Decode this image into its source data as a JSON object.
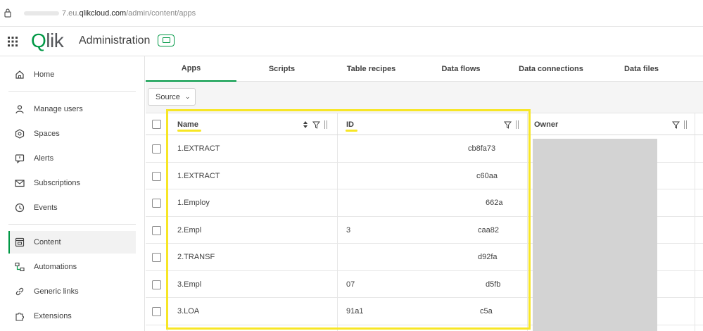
{
  "browser": {
    "url_prefix": "7.eu.",
    "url_domain": "qlikcloud.com",
    "url_path": "/admin/content/apps"
  },
  "header": {
    "logo_q": "Q",
    "logo_rest": "lik",
    "title": "Administration"
  },
  "sidebar": {
    "items": [
      {
        "label": "Home",
        "icon": "home-icon"
      },
      {
        "label": "Manage users",
        "icon": "user-icon"
      },
      {
        "label": "Spaces",
        "icon": "spaces-icon"
      },
      {
        "label": "Alerts",
        "icon": "alert-icon"
      },
      {
        "label": "Subscriptions",
        "icon": "mail-icon"
      },
      {
        "label": "Events",
        "icon": "clock-icon"
      },
      {
        "label": "Content",
        "icon": "content-icon"
      },
      {
        "label": "Automations",
        "icon": "automation-icon"
      },
      {
        "label": "Generic links",
        "icon": "link-icon"
      },
      {
        "label": "Extensions",
        "icon": "puzzle-icon"
      }
    ],
    "active": "Content"
  },
  "tabs": [
    {
      "label": "Apps"
    },
    {
      "label": "Scripts"
    },
    {
      "label": "Table recipes"
    },
    {
      "label": "Data flows"
    },
    {
      "label": "Data connections"
    },
    {
      "label": "Data files"
    }
  ],
  "filter": {
    "source_label": "Source"
  },
  "table": {
    "headers": {
      "name": "Name",
      "id": "ID",
      "owner": "Owner"
    },
    "rows": [
      {
        "name": "1.EXTRACT",
        "id_start": "",
        "id_end": "cb8fa73"
      },
      {
        "name": "1.EXTRACT",
        "id_start": "",
        "id_end": "c60aa"
      },
      {
        "name": "1.Employ",
        "id_start": "",
        "id_end": "662a"
      },
      {
        "name": "2.Empl",
        "id_start": "3",
        "id_end": "caa82"
      },
      {
        "name": "2.TRANSF",
        "id_start": "",
        "id_end": "d92fa"
      },
      {
        "name": "3.Empl",
        "id_start": "07",
        "id_end": "d5fb"
      },
      {
        "name": "3.LOA",
        "id_start": "91a1",
        "id_end": "c5a"
      }
    ]
  },
  "colors": {
    "accent": "#009845",
    "highlight": "#f7e626",
    "owner_redaction": "#d3d3d3"
  }
}
